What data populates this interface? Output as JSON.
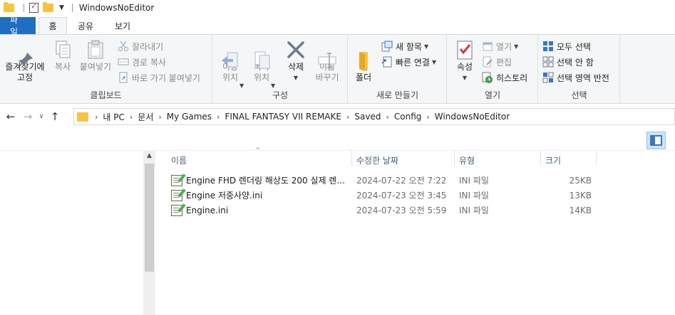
{
  "window": {
    "title": "WindowsNoEditor"
  },
  "tabs": {
    "file": "파일",
    "home": "홈",
    "share": "공유",
    "view": "보기"
  },
  "ribbon": {
    "clipboard": {
      "label": "클립보드",
      "pin": "즐겨찾기에\n고정",
      "copy": "복사",
      "paste": "붙여넣기",
      "cut": "잘라내기",
      "copy_path": "경로 복사",
      "paste_shortcut": "바로 가기 붙여넣기"
    },
    "organize": {
      "label": "구성",
      "move_to": "이동\n위치",
      "copy_to": "복사\n위치",
      "delete": "삭제",
      "rename": "이름\n바꾸기"
    },
    "new": {
      "label": "새로 만들기",
      "new_folder": "새\n폴더",
      "new_item": "새 항목",
      "easy_access": "빠른 연결"
    },
    "open": {
      "label": "열기",
      "properties": "속성",
      "open": "열기",
      "edit": "편집",
      "history": "히스토리"
    },
    "select": {
      "label": "선택",
      "select_all": "모두 선택",
      "select_none": "선택 안 함",
      "invert": "선택 영역 반전"
    }
  },
  "address": {
    "crumbs": [
      "내 PC",
      "문서",
      "My Games",
      "FINAL FANTASY VII REMAKE",
      "Saved",
      "Config",
      "WindowsNoEditor"
    ]
  },
  "columns": {
    "name": "이름",
    "date": "수정한 날짜",
    "type": "유형",
    "size": "크기"
  },
  "files": [
    {
      "name": "Engine FHD 렌더링 해상도 200 실제 렌...",
      "date": "2024-07-22 오전 7:22",
      "type": "INI 파일",
      "size": "25KB"
    },
    {
      "name": "Engine 저중사양.ini",
      "date": "2024-07-23 오전 3:45",
      "type": "INI 파일",
      "size": "13KB"
    },
    {
      "name": "Engine.ini",
      "date": "2024-07-23 오전 5:59",
      "type": "INI 파일",
      "size": "14KB"
    }
  ]
}
